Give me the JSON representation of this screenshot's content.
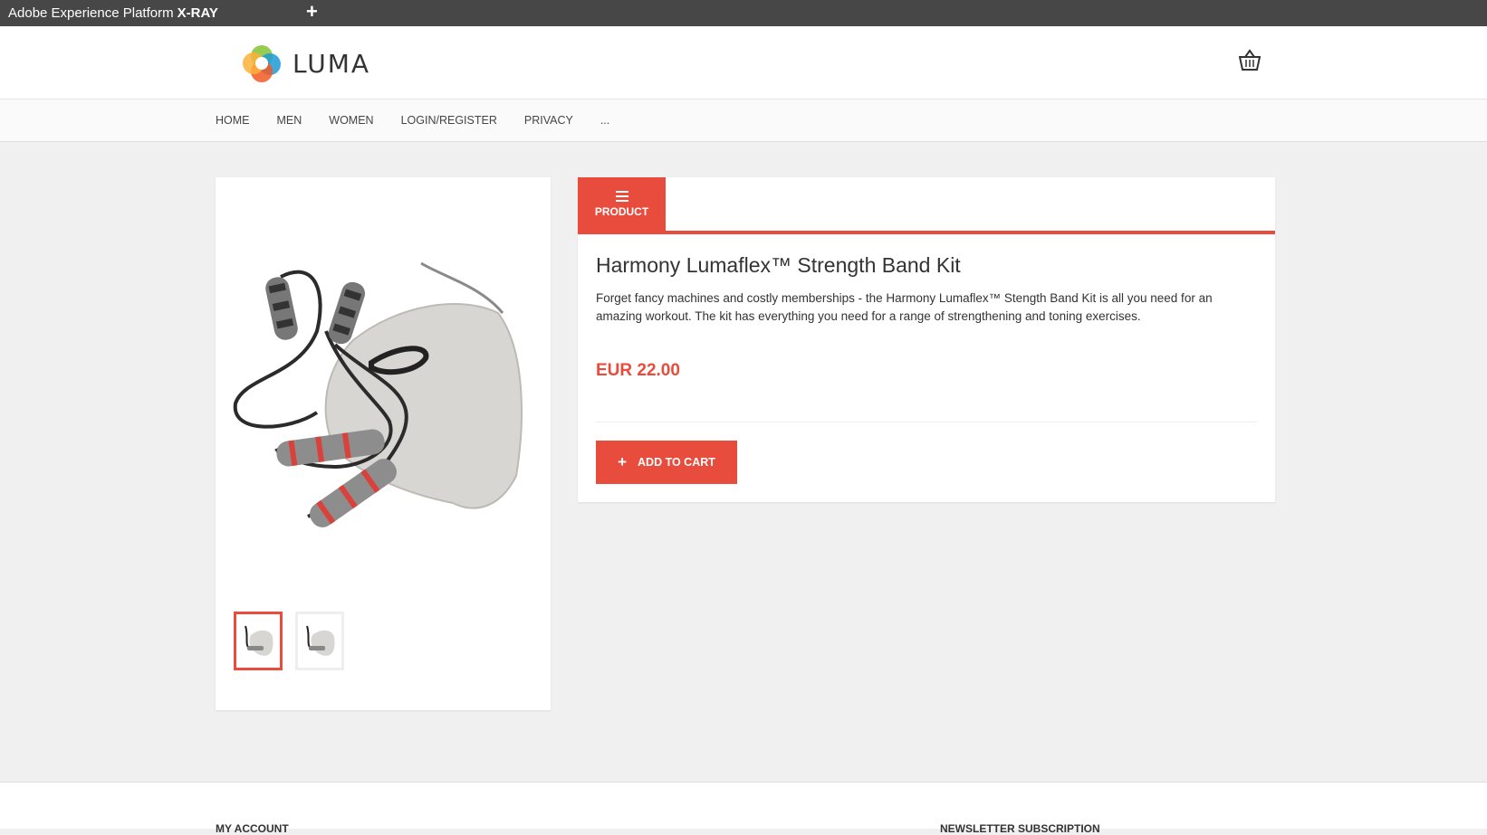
{
  "xray": {
    "title": "Adobe Experience Platform",
    "title_bold": "X-RAY",
    "add_symbol": "+"
  },
  "header": {
    "logo_text": "LUMA",
    "cart_icon": "cart-icon"
  },
  "nav": {
    "items": [
      "HOME",
      "MEN",
      "WOMEN",
      "LOGIN/REGISTER",
      "PRIVACY",
      "..."
    ]
  },
  "product": {
    "tab_label": "PRODUCT",
    "tab_icon": "menu-icon",
    "title": "Harmony Lumaflex™ Strength Band Kit",
    "description": "Forget fancy machines and costly memberships - the Harmony Lumaflex™ Stength Band Kit is all you need for an amazing workout. The kit has everything you need for a range of strengthening and toning exercises.",
    "price": "EUR 22.00",
    "add_to_cart_label": "ADD TO CART",
    "thumbnails": 2
  },
  "footer": {
    "my_account": "MY ACCOUNT",
    "newsletter": "NEWSLETTER SUBSCRIPTION"
  },
  "colors": {
    "accent": "#e74c3c",
    "xray_bar": "#474747",
    "background": "#f0f0f0"
  }
}
